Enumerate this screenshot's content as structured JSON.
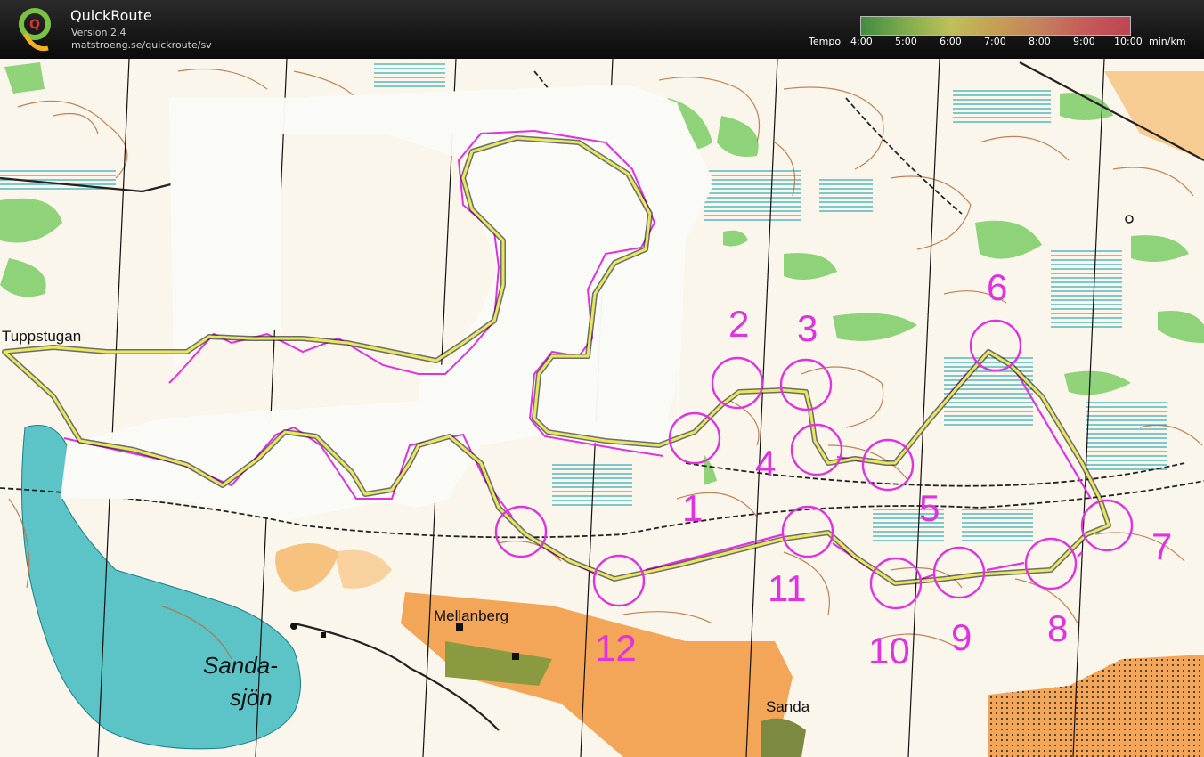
{
  "app": {
    "title": "QuickRoute",
    "version": "Version 2.4",
    "url": "matstroeng.se/quickroute/sv"
  },
  "tempo_legend": {
    "label": "Tempo",
    "ticks": [
      "4:00",
      "5:00",
      "6:00",
      "7:00",
      "8:00",
      "9:00",
      "10:00"
    ],
    "unit": "min/km",
    "colors": [
      "#4aa84a",
      "#9ad05a",
      "#e8e86a",
      "#f0c060",
      "#f09a70",
      "#f06a6a",
      "#e85060"
    ]
  },
  "map": {
    "place_names": {
      "tuppstugan": "Tuppstugan",
      "mellanberg": "Mellanberg",
      "sanda": "Sanda",
      "sandasjon_1": "Sanda-",
      "sandasjon_2": "sjön"
    },
    "controls": [
      "1",
      "2",
      "3",
      "4",
      "5",
      "6",
      "7",
      "8",
      "9",
      "10",
      "11",
      "12"
    ],
    "colors": {
      "paper": "#fbf6ec",
      "contour": "#b5703d",
      "lake": "#5cc3c7",
      "marsh": "#29a9b5",
      "green": "#6cc05a",
      "open": "#f1a45a",
      "course": "#e032e0",
      "route": "#e8e860"
    }
  }
}
